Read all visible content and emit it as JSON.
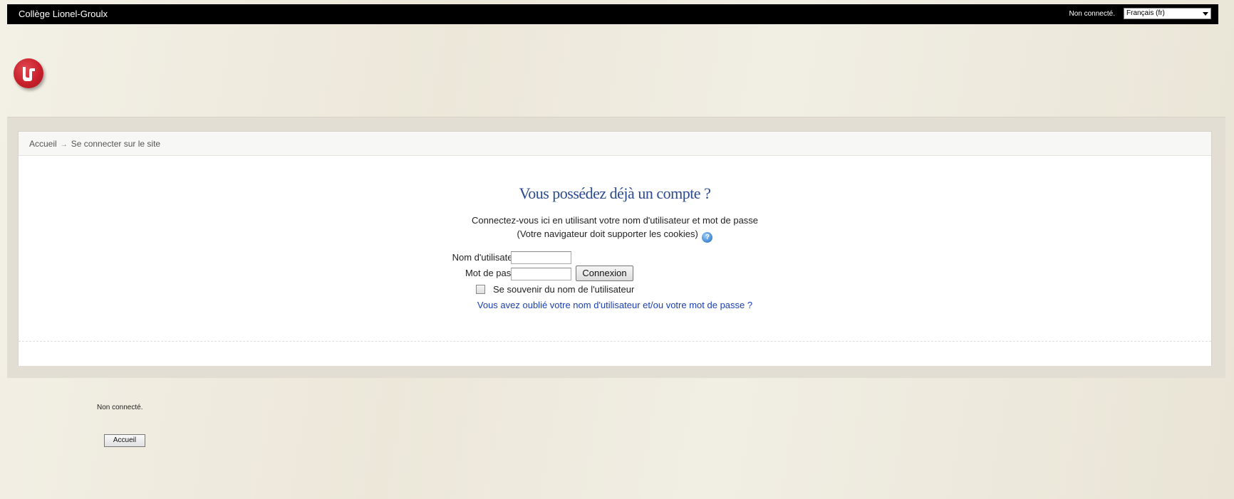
{
  "header": {
    "site_name": "Collège Lionel-Groulx",
    "login_info": "Non connecté.",
    "language_select": {
      "selected": "Français (fr)"
    }
  },
  "breadcrumb": {
    "home": "Accueil",
    "separator": "→",
    "current": "Se connecter sur le site"
  },
  "login": {
    "title": "Vous possédez déjà un compte ?",
    "description_line1": "Connectez-vous ici en utilisant votre nom d'utilisateur et mot de passe",
    "description_line2": "(Votre navigateur doit supporter les cookies)",
    "username_label": "Nom d'utilisateur",
    "username_value": "",
    "password_label": "Mot de passe",
    "password_value": "",
    "login_button": "Connexion",
    "remember_label": "Se souvenir du nom de l'utilisateur",
    "remember_checked": false,
    "forgot_link": "Vous avez oublié votre nom d'utilisateur et/ou votre mot de passe ?"
  },
  "footer": {
    "login_info": "Non connecté.",
    "home_button": "Accueil"
  },
  "colors": {
    "title_blue": "#2b4a8f",
    "link_blue": "#1a3fb0",
    "logo_red": "#c8202c",
    "topbar": "#000000"
  }
}
